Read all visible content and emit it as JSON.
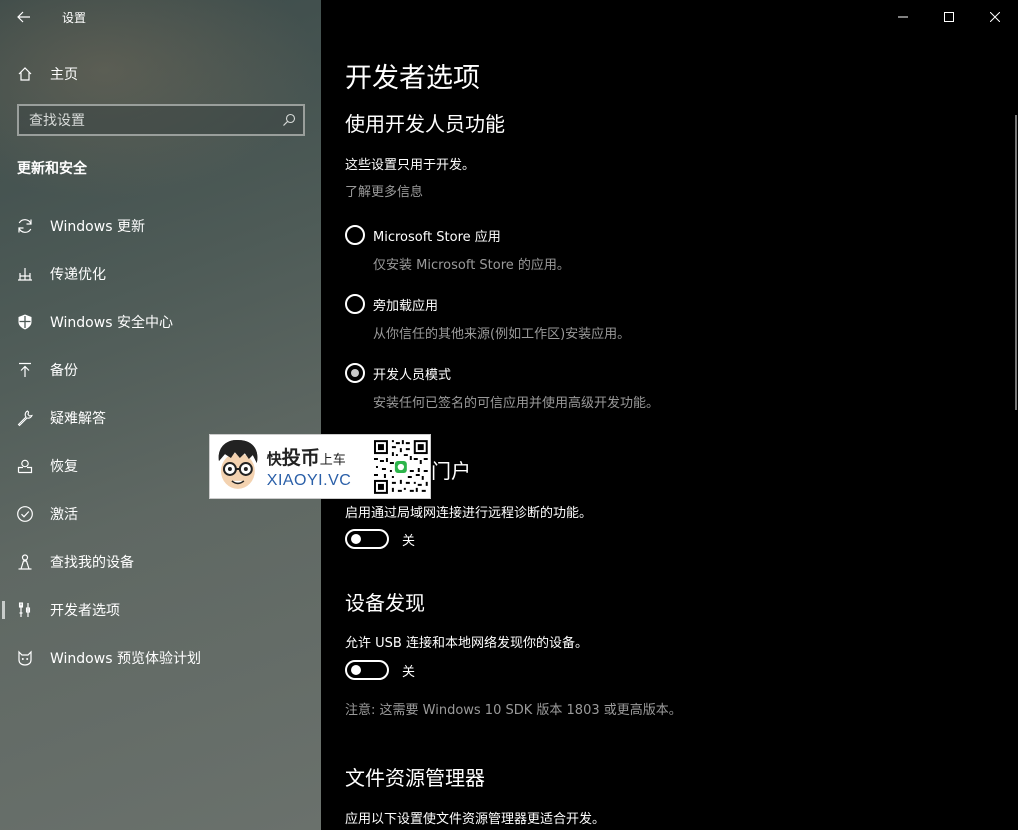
{
  "window": {
    "title": "设置"
  },
  "sidebar": {
    "home_label": "主页",
    "search_placeholder": "查找设置",
    "section_title": "更新和安全",
    "items": [
      {
        "label": "Windows 更新",
        "icon": "sync-icon"
      },
      {
        "label": "传递优化",
        "icon": "delivery-optimization-icon"
      },
      {
        "label": "Windows 安全中心",
        "icon": "shield-icon"
      },
      {
        "label": "备份",
        "icon": "backup-upload-icon"
      },
      {
        "label": "疑难解答",
        "icon": "wrench-icon"
      },
      {
        "label": "恢复",
        "icon": "recovery-icon"
      },
      {
        "label": "激活",
        "icon": "check-circle-icon"
      },
      {
        "label": "查找我的设备",
        "icon": "find-device-person-icon"
      },
      {
        "label": "开发者选项",
        "icon": "developer-tools-icon",
        "active": true
      },
      {
        "label": "Windows 预览体验计划",
        "icon": "insider-cat-icon"
      }
    ]
  },
  "main": {
    "page_title": "开发者选项",
    "dev_features": {
      "heading": "使用开发人员功能",
      "description": "这些设置只用于开发。",
      "learn_more": "了解更多信息",
      "options": [
        {
          "label": "Microsoft Store 应用",
          "desc": "仅安装 Microsoft Store 的应用。",
          "checked": false
        },
        {
          "label": "旁加载应用",
          "desc": "从你信任的其他来源(例如工作区)安装应用。",
          "checked": false
        },
        {
          "label": "开发人员模式",
          "desc": "安装任何已签名的可信应用并使用高级开发功能。",
          "checked": true
        }
      ]
    },
    "device_portal": {
      "heading_visible": "门户",
      "description": "启用通过局域网连接进行远程诊断的功能。",
      "toggle_label": "关"
    },
    "device_discovery": {
      "heading": "设备发现",
      "description": "允许 USB 连接和本地网络发现你的设备。",
      "toggle_label": "关",
      "note": "注意: 这需要 Windows 10 SDK 版本 1803 或更高版本。"
    },
    "file_explorer": {
      "heading": "文件资源管理器",
      "description": "应用以下设置使文件资源管理器更适合开发。"
    }
  },
  "watermark": {
    "text1_a": "快",
    "text1_b": "投币",
    "text1_c": "上车",
    "text2": "XIAOYI.VC"
  }
}
